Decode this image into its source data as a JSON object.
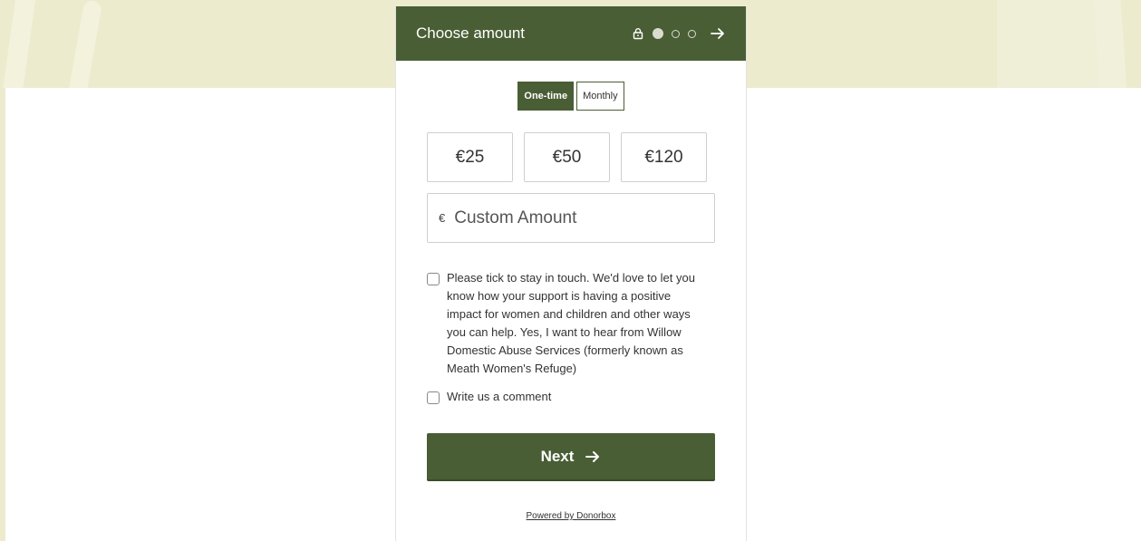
{
  "header": {
    "title": "Choose amount",
    "icons": [
      "lock-icon",
      "step-dot-active",
      "step-dot",
      "step-dot",
      "arrow-right-icon"
    ]
  },
  "frequency": {
    "options": [
      "One-time",
      "Monthly"
    ],
    "selected": "One-time"
  },
  "amounts": {
    "currency": "€",
    "options": [
      "€25",
      "€50",
      "€120"
    ],
    "custom_placeholder": "Custom Amount"
  },
  "consent": {
    "stay_in_touch_label": "Please tick to stay in touch. We'd love to let you know how your support is having a positive impact for women and children and other ways you can help. Yes, I want to hear from Willow Domestic Abuse Services (formerly known as Meath Women's Refuge)",
    "comment_label": "Write us a comment"
  },
  "next_button": {
    "label": "Next"
  },
  "footer": {
    "powered_by": "Powered by Donorbox"
  },
  "colors": {
    "brand": "#4a5e35",
    "background_band": "#ecebce"
  }
}
